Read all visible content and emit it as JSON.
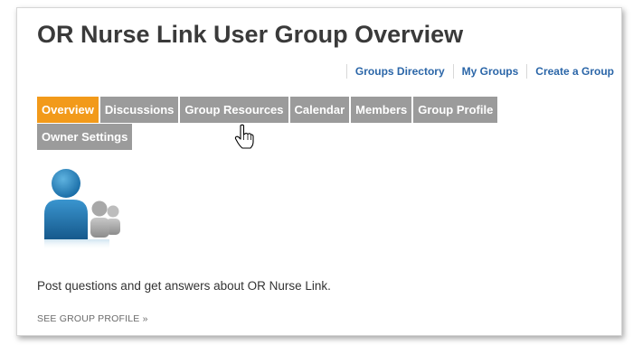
{
  "page": {
    "title": "OR Nurse Link User Group Overview"
  },
  "top_links": {
    "groups_directory": "Groups Directory",
    "my_groups": "My Groups",
    "create_group": "Create a Group"
  },
  "tabs": [
    {
      "label": "Overview",
      "active": true
    },
    {
      "label": "Discussions",
      "active": false
    },
    {
      "label": "Group Resources",
      "active": false
    },
    {
      "label": "Calendar",
      "active": false
    },
    {
      "label": "Members",
      "active": false
    },
    {
      "label": "Group Profile",
      "active": false
    },
    {
      "label": "Owner Settings",
      "active": false
    }
  ],
  "colors": {
    "active_tab": "#f29a1a",
    "inactive_tab": "#9b9b9b",
    "link": "#2b66a8"
  },
  "group_icon": "user-group-icon",
  "description": "Post questions and get answers about OR Nurse Link.",
  "see_profile_link": "SEE GROUP PROFILE »"
}
